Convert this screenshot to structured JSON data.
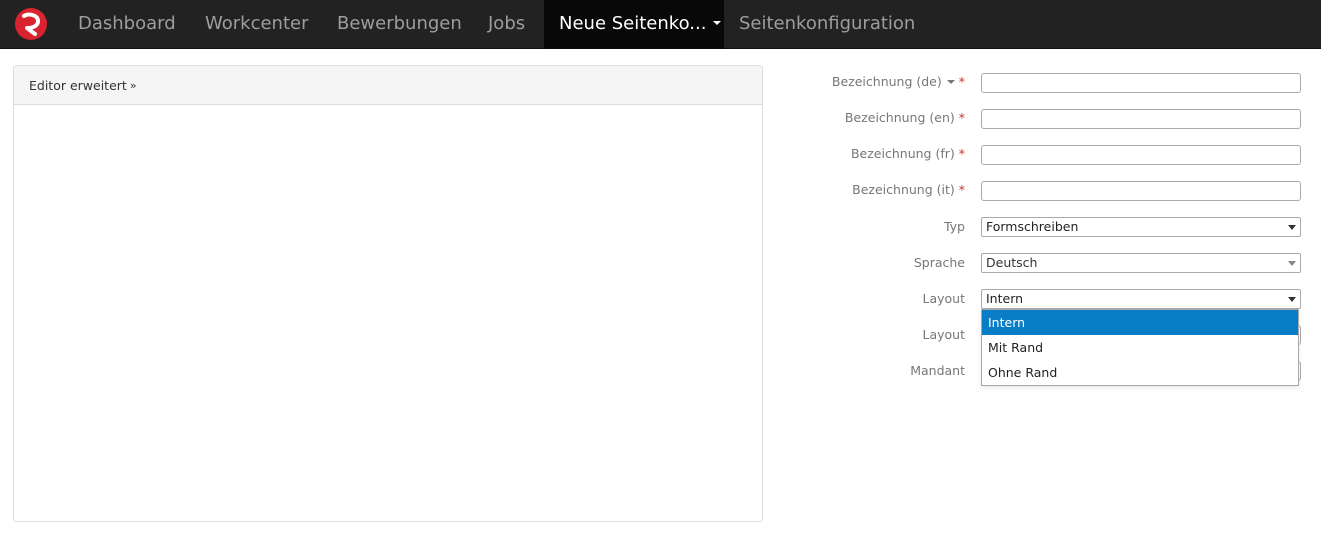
{
  "nav": {
    "items": [
      {
        "label": "Dashboard"
      },
      {
        "label": "Workcenter"
      },
      {
        "label": "Bewerbungen"
      },
      {
        "label": "Jobs"
      },
      {
        "label": "Neue Seitenko..."
      },
      {
        "label": "Seitenkonfiguration"
      }
    ],
    "active_index": 4,
    "background": "#222222",
    "active_background": "#080808",
    "brand_color": "#d9232e"
  },
  "editor": {
    "heading": "Editor erweitert",
    "toggle_icon": "double-chevron-down-icon"
  },
  "form": {
    "fields": [
      {
        "label": "Bezeichnung (de)",
        "required": "*",
        "value": ""
      },
      {
        "label": "Bezeichnung (en)",
        "required": "*",
        "value": ""
      },
      {
        "label": "Bezeichnung (fr)",
        "required": "*",
        "value": ""
      },
      {
        "label": "Bezeichnung (it)",
        "required": "*",
        "value": ""
      }
    ],
    "typ": {
      "label": "Typ",
      "value": "Formschreiben"
    },
    "sprache": {
      "label": "Sprache",
      "value": "Deutsch"
    },
    "layout": {
      "label": "Layout",
      "value": "Intern",
      "options": [
        "Intern",
        "Mit Rand",
        "Ohne Rand"
      ],
      "selected_index": 0,
      "highlight_color": "#0a7dc7"
    },
    "layout2": {
      "label": "Layout"
    },
    "mandant": {
      "label": "Mandant"
    }
  }
}
